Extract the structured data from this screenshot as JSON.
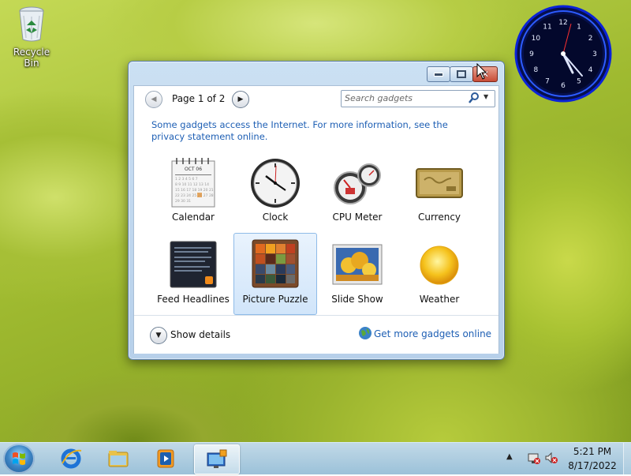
{
  "desktop": {
    "icons": [
      {
        "label": "Recycle Bin",
        "icon": "recycle-bin-icon"
      }
    ]
  },
  "clock_gadget": {
    "numerals": [
      "12",
      "1",
      "2",
      "3",
      "4",
      "5",
      "6",
      "7",
      "8",
      "9",
      "10",
      "11"
    ],
    "accent": "#1a44ff"
  },
  "window": {
    "title_buttons": {
      "minimize": "minimize-icon",
      "maximize": "maximize-icon",
      "close": "close-icon"
    },
    "toolbar": {
      "page_label": "Page 1 of 2",
      "search_placeholder": "Search gadgets"
    },
    "privacy_text": "Some gadgets access the Internet.  For more information, see the privacy statement online.",
    "gadgets": [
      {
        "label": "Calendar",
        "icon": "calendar-icon",
        "selected": false
      },
      {
        "label": "Clock",
        "icon": "clock-icon",
        "selected": false
      },
      {
        "label": "CPU Meter",
        "icon": "cpu-meter-icon",
        "selected": false
      },
      {
        "label": "Currency",
        "icon": "currency-icon",
        "selected": false
      },
      {
        "label": "Feed Headlines",
        "icon": "feed-headlines-icon",
        "selected": false
      },
      {
        "label": "Picture Puzzle",
        "icon": "picture-puzzle-icon",
        "selected": true
      },
      {
        "label": "Slide Show",
        "icon": "slide-show-icon",
        "selected": false
      },
      {
        "label": "Weather",
        "icon": "weather-icon",
        "selected": false
      }
    ],
    "calendar_month": "OCT 06",
    "footer": {
      "show_details": "Show details",
      "more_gadgets": "Get more gadgets online"
    }
  },
  "taskbar": {
    "apps": [
      "internet-explorer-icon",
      "windows-explorer-icon",
      "media-player-icon",
      "gadgets-icon"
    ],
    "time": "5:21 PM",
    "date": "8/17/2022"
  },
  "colors": {
    "link": "#1e5fb4",
    "selection": "#d1e5fa"
  }
}
